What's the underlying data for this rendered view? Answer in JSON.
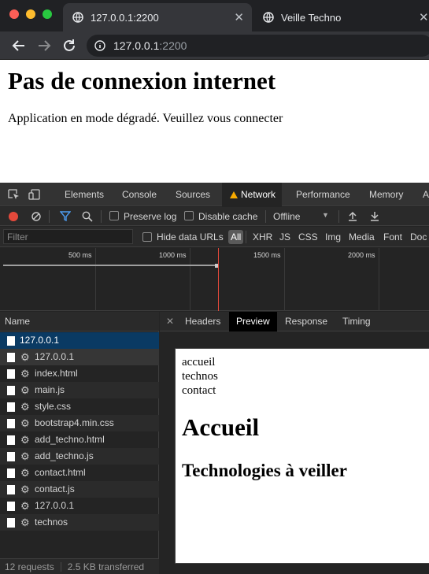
{
  "browser": {
    "tabs": [
      {
        "title": "127.0.0.1:2200",
        "active": true
      },
      {
        "title": "Veille Techno",
        "active": false
      }
    ],
    "url": {
      "host": "127.0.0.1",
      "port": ":2200"
    }
  },
  "page": {
    "heading": "Pas de connexion internet",
    "message": "Application en mode dégradé. Veuillez vous connecter"
  },
  "devtools": {
    "tabs": [
      "Elements",
      "Console",
      "Sources",
      "Network",
      "Performance",
      "Memory",
      "A"
    ],
    "active_tab": "Network",
    "toolbar": {
      "preserve_log": "Preserve log",
      "disable_cache": "Disable cache",
      "throttling": "Offline"
    },
    "filter": {
      "placeholder": "Filter",
      "hide_data_urls": "Hide data URLs",
      "types": [
        "All",
        "XHR",
        "JS",
        "CSS",
        "Img",
        "Media",
        "Font",
        "Doc"
      ]
    },
    "timeline": {
      "ticks": [
        "500 ms",
        "1000 ms",
        "1500 ms",
        "2000 ms"
      ]
    },
    "requests": {
      "header": "Name",
      "items": [
        {
          "name": "127.0.0.1",
          "gear": false
        },
        {
          "name": "127.0.0.1",
          "gear": true
        },
        {
          "name": "index.html",
          "gear": true
        },
        {
          "name": "main.js",
          "gear": true
        },
        {
          "name": "style.css",
          "gear": true
        },
        {
          "name": "bootstrap4.min.css",
          "gear": true
        },
        {
          "name": "add_techno.html",
          "gear": true
        },
        {
          "name": "add_techno.js",
          "gear": true
        },
        {
          "name": "contact.html",
          "gear": true
        },
        {
          "name": "contact.js",
          "gear": true
        },
        {
          "name": "127.0.0.1",
          "gear": true
        },
        {
          "name": "technos",
          "gear": true
        }
      ],
      "count": "12 requests",
      "transferred": "2.5 KB transferred"
    },
    "detail": {
      "tabs": [
        "Headers",
        "Preview",
        "Response",
        "Timing"
      ],
      "active": "Preview",
      "preview": {
        "nav": [
          "accueil",
          "technos",
          "contact"
        ],
        "h1": "Accueil",
        "h2": "Technologies à veiller"
      }
    },
    "colors": {
      "record": "#e4493b",
      "warning": "#f9ab00",
      "selected_row": "#0a3a63"
    }
  }
}
